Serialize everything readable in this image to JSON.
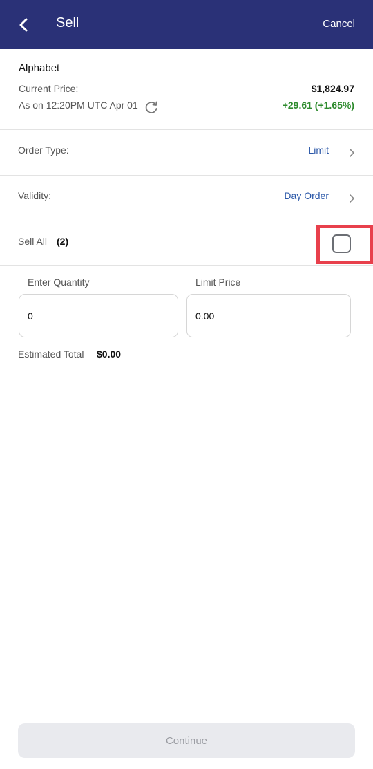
{
  "header": {
    "title": "Sell",
    "cancel_label": "Cancel",
    "background": "#2a3177"
  },
  "stock": {
    "name": "Alphabet",
    "current_price_label": "Current Price:",
    "price": "$1,824.97",
    "as_on": "As on 12:20PM UTC Apr 01",
    "change": "+29.61 (+1.65%)",
    "change_color": "#2e8b2e"
  },
  "order_type": {
    "label": "Order Type:",
    "value": "Limit"
  },
  "validity": {
    "label": "Validity:",
    "value": "Day Order"
  },
  "sell_all": {
    "label": "Sell All",
    "count": "(2)",
    "checked": false
  },
  "quantity": {
    "label": "Enter Quantity",
    "value": "0"
  },
  "limit_price": {
    "label": "Limit Price",
    "value": "0.00"
  },
  "estimated_total": {
    "label": "Estimated Total",
    "value": "$0.00"
  },
  "continue_label": "Continue",
  "icons": {
    "back": "chevron-left-icon",
    "refresh": "refresh-icon",
    "row_arrow": "chevron-right-icon"
  },
  "accent": "#2a57a8",
  "highlight_color": "#e8404c"
}
